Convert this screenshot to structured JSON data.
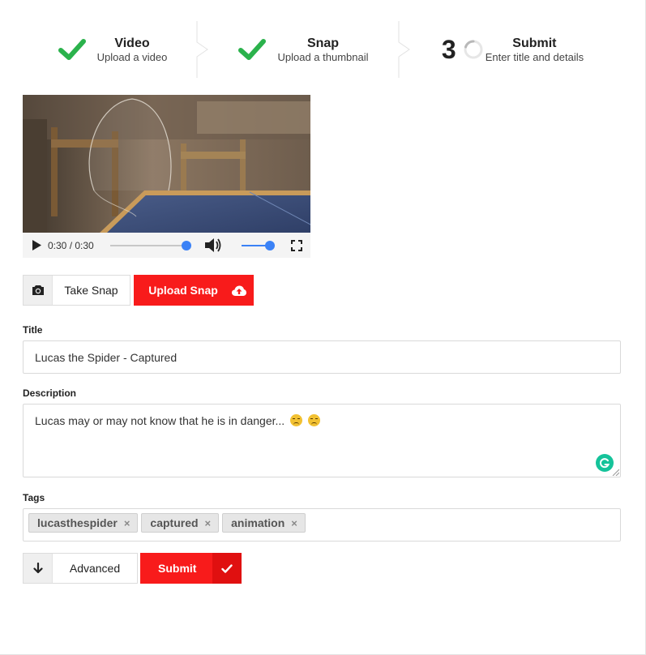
{
  "steps": [
    {
      "title": "Video",
      "description": "Upload a video",
      "state": "done"
    },
    {
      "title": "Snap",
      "description": "Upload a thumbnail",
      "state": "done"
    },
    {
      "number": "3",
      "title": "Submit",
      "description": "Enter title and details",
      "state": "active"
    }
  ],
  "video": {
    "time": "0:30 / 0:30",
    "progress": 1.0,
    "volume": 1.0
  },
  "snap": {
    "take_label": "Take Snap",
    "upload_label": "Upload Snap"
  },
  "form": {
    "title_label": "Title",
    "title_value": "Lucas the Spider - Captured",
    "description_label": "Description",
    "description_value": "Lucas may or may not know that he is in danger...",
    "tags_label": "Tags",
    "tags": [
      "lucasthespider",
      "captured",
      "animation"
    ],
    "tag_remove_symbol": "×"
  },
  "actions": {
    "advanced_label": "Advanced",
    "submit_label": "Submit"
  },
  "colors": {
    "accent_red": "#f81b1b",
    "check_green": "#2bb24c",
    "slider_blue": "#3b82f6"
  }
}
